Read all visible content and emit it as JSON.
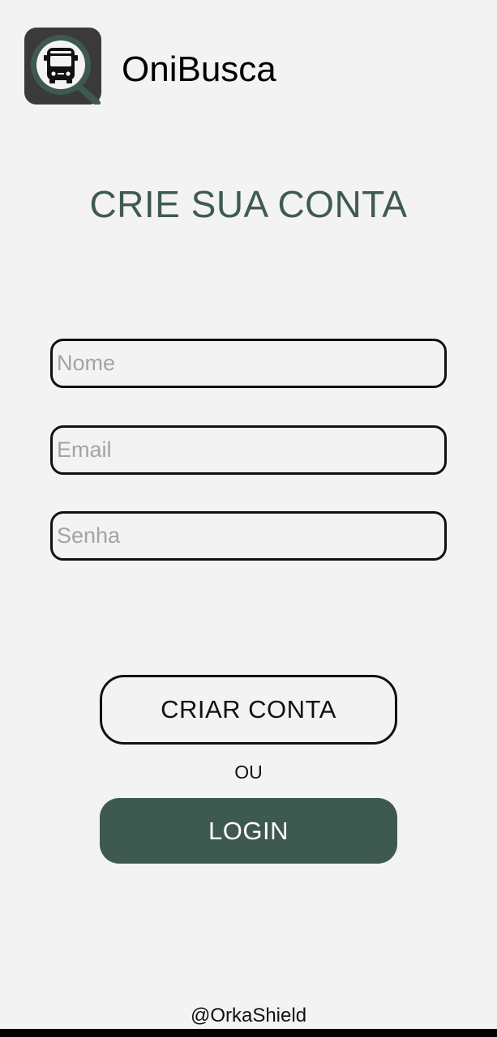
{
  "app": {
    "name": "OniBusca",
    "logo_icon": "bus-search-icon"
  },
  "page": {
    "title": "CRIE SUA CONTA"
  },
  "form": {
    "name_placeholder": "Nome",
    "email_placeholder": "Email",
    "password_placeholder": "Senha",
    "name_value": "",
    "email_value": "",
    "password_value": ""
  },
  "actions": {
    "create_account_label": "CRIAR CONTA",
    "or_label": "OU",
    "login_label": "LOGIN"
  },
  "footer": {
    "credit": "@OrkaShield"
  },
  "colors": {
    "background": "#f3f3f3",
    "accent": "#3e5950",
    "title": "#3f5a52",
    "placeholder": "#a3a3a3"
  }
}
